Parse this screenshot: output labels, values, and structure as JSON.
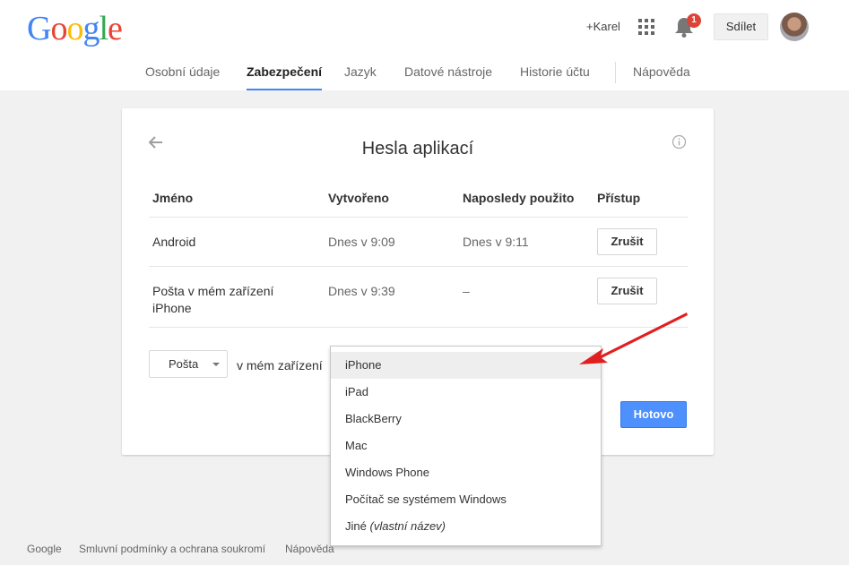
{
  "header": {
    "logo": [
      "G",
      "o",
      "o",
      "g",
      "l",
      "e"
    ],
    "plus_name": "+Karel",
    "notification_count": "1",
    "share_label": "Sdílet"
  },
  "nav": {
    "items": [
      "Osobní údaje",
      "Zabezpečení",
      "Jazyk",
      "Datové nástroje",
      "Historie účtu",
      "Nápověda"
    ],
    "active_index": 1
  },
  "card": {
    "title": "Hesla aplikací",
    "columns": [
      "Jméno",
      "Vytvořeno",
      "Naposledy použito",
      "Přístup"
    ],
    "rows": [
      {
        "name": "Android",
        "name_line2": "",
        "created": "Dnes v 9:09",
        "last_used": "Dnes v 9:11",
        "action": "Zrušit"
      },
      {
        "name": "Pošta v mém zařízení",
        "name_line2": "iPhone",
        "created": "Dnes v 9:39",
        "last_used": "–",
        "action": "Zrušit"
      }
    ],
    "app_select_value": "Pošta",
    "device_label": "v mém zařízení",
    "done_label": "Hotovo"
  },
  "dropdown": {
    "options": [
      "iPhone",
      "iPad",
      "BlackBerry",
      "Mac",
      "Windows Phone",
      "Počítač se systémem Windows"
    ],
    "custom_prefix": "Jiné",
    "custom_italic": "(vlastní název)",
    "selected": "iPhone"
  },
  "footer": {
    "links": [
      "Google",
      "Smluvní podmínky a ochrana soukromí",
      "Nápověda"
    ]
  },
  "colors": {
    "accent_blue": "#4285f4",
    "done_button": "#4d90fe",
    "badge_red": "#db4437",
    "annotation_arrow": "#e02020"
  }
}
